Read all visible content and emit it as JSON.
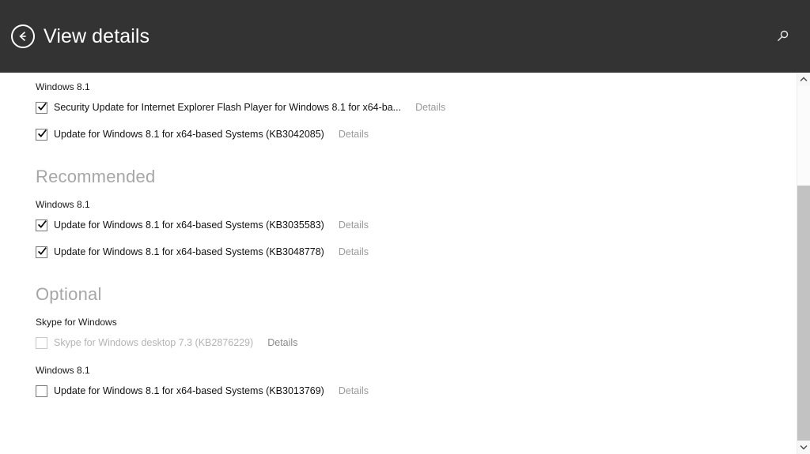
{
  "header": {
    "title": "View details",
    "back_icon": "back-arrow-circle-icon",
    "search_icon": "search-icon"
  },
  "scrollbar": {
    "up_icon": "chevron-up-icon",
    "down_icon": "chevron-down-icon"
  },
  "sections": [
    {
      "heading": "",
      "groups": [
        {
          "label": "Windows 8.1",
          "items": [
            {
              "label": "Security Update for Internet Explorer Flash Player for Windows 8.1 for x64-ba...",
              "checked": true,
              "enabled": true,
              "details_label": "Details"
            },
            {
              "label": "Update for Windows 8.1 for x64-based Systems (KB3042085)",
              "checked": true,
              "enabled": true,
              "details_label": "Details"
            }
          ]
        }
      ]
    },
    {
      "heading": "Recommended",
      "groups": [
        {
          "label": "Windows 8.1",
          "items": [
            {
              "label": "Update for Windows 8.1 for x64-based Systems (KB3035583)",
              "checked": true,
              "enabled": true,
              "details_label": "Details"
            },
            {
              "label": "Update for Windows 8.1 for x64-based Systems (KB3048778)",
              "checked": true,
              "enabled": true,
              "details_label": "Details"
            }
          ]
        }
      ]
    },
    {
      "heading": "Optional",
      "groups": [
        {
          "label": "Skype for Windows",
          "items": [
            {
              "label": "Skype for Windows desktop 7.3 (KB2876229)",
              "checked": false,
              "enabled": false,
              "details_label": "Details"
            }
          ]
        },
        {
          "label": "Windows 8.1",
          "items": [
            {
              "label": "Update for Windows 8.1 for x64-based Systems (KB3013769)",
              "checked": false,
              "enabled": true,
              "details_label": "Details"
            }
          ]
        }
      ]
    }
  ],
  "colors": {
    "header_background": "#333333",
    "header_text": "#ffffff",
    "section_heading": "#a6a6a6",
    "item_text": "#111111",
    "item_text_disabled": "#b4b4b4",
    "details_text": "#9a9a9a",
    "scrollbar_thumb": "#c2c2c2"
  }
}
